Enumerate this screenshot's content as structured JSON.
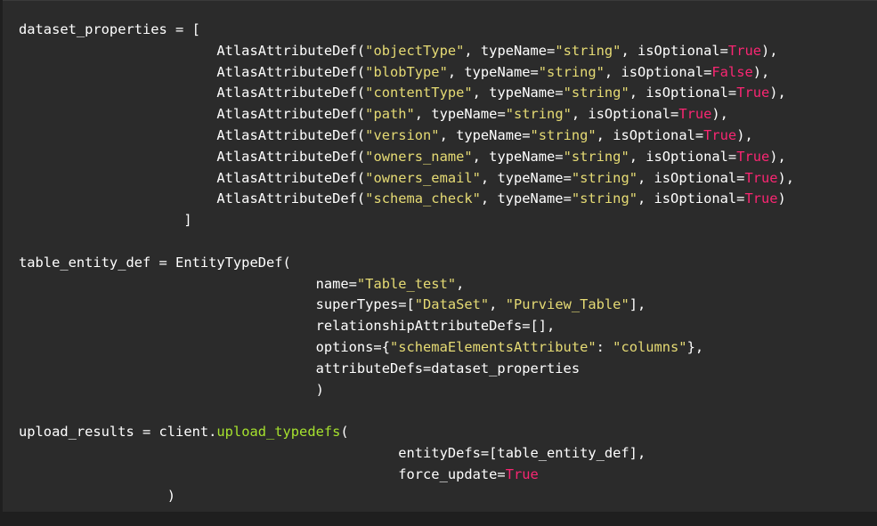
{
  "colors": {
    "background": "#2b2b2b",
    "plain": "#ffffff",
    "string": "#e6db74",
    "bool": "#f92672",
    "function": "#a6e22e"
  },
  "code": {
    "lines": [
      [
        {
          "t": "plain",
          "v": "dataset_properties = ["
        }
      ],
      [
        {
          "t": "plain",
          "v": "                        AtlasAttributeDef("
        },
        {
          "t": "string",
          "v": "\"objectType\""
        },
        {
          "t": "plain",
          "v": ", typeName="
        },
        {
          "t": "string",
          "v": "\"string\""
        },
        {
          "t": "plain",
          "v": ", isOptional="
        },
        {
          "t": "bool",
          "v": "True"
        },
        {
          "t": "plain",
          "v": "),"
        }
      ],
      [
        {
          "t": "plain",
          "v": "                        AtlasAttributeDef("
        },
        {
          "t": "string",
          "v": "\"blobType\""
        },
        {
          "t": "plain",
          "v": ", typeName="
        },
        {
          "t": "string",
          "v": "\"string\""
        },
        {
          "t": "plain",
          "v": ", isOptional="
        },
        {
          "t": "bool",
          "v": "False"
        },
        {
          "t": "plain",
          "v": "),"
        }
      ],
      [
        {
          "t": "plain",
          "v": "                        AtlasAttributeDef("
        },
        {
          "t": "string",
          "v": "\"contentType\""
        },
        {
          "t": "plain",
          "v": ", typeName="
        },
        {
          "t": "string",
          "v": "\"string\""
        },
        {
          "t": "plain",
          "v": ", isOptional="
        },
        {
          "t": "bool",
          "v": "True"
        },
        {
          "t": "plain",
          "v": "),"
        }
      ],
      [
        {
          "t": "plain",
          "v": "                        AtlasAttributeDef("
        },
        {
          "t": "string",
          "v": "\"path\""
        },
        {
          "t": "plain",
          "v": ", typeName="
        },
        {
          "t": "string",
          "v": "\"string\""
        },
        {
          "t": "plain",
          "v": ", isOptional="
        },
        {
          "t": "bool",
          "v": "True"
        },
        {
          "t": "plain",
          "v": "),"
        }
      ],
      [
        {
          "t": "plain",
          "v": "                        AtlasAttributeDef("
        },
        {
          "t": "string",
          "v": "\"version\""
        },
        {
          "t": "plain",
          "v": ", typeName="
        },
        {
          "t": "string",
          "v": "\"string\""
        },
        {
          "t": "plain",
          "v": ", isOptional="
        },
        {
          "t": "bool",
          "v": "True"
        },
        {
          "t": "plain",
          "v": "),"
        }
      ],
      [
        {
          "t": "plain",
          "v": "                        AtlasAttributeDef("
        },
        {
          "t": "string",
          "v": "\"owners_name\""
        },
        {
          "t": "plain",
          "v": ", typeName="
        },
        {
          "t": "string",
          "v": "\"string\""
        },
        {
          "t": "plain",
          "v": ", isOptional="
        },
        {
          "t": "bool",
          "v": "True"
        },
        {
          "t": "plain",
          "v": "),"
        }
      ],
      [
        {
          "t": "plain",
          "v": "                        AtlasAttributeDef("
        },
        {
          "t": "string",
          "v": "\"owners_email\""
        },
        {
          "t": "plain",
          "v": ", typeName="
        },
        {
          "t": "string",
          "v": "\"string\""
        },
        {
          "t": "plain",
          "v": ", isOptional="
        },
        {
          "t": "bool",
          "v": "True"
        },
        {
          "t": "plain",
          "v": "),"
        }
      ],
      [
        {
          "t": "plain",
          "v": "                        AtlasAttributeDef("
        },
        {
          "t": "string",
          "v": "\"schema_check\""
        },
        {
          "t": "plain",
          "v": ", typeName="
        },
        {
          "t": "string",
          "v": "\"string\""
        },
        {
          "t": "plain",
          "v": ", isOptional="
        },
        {
          "t": "bool",
          "v": "True"
        },
        {
          "t": "plain",
          "v": ")"
        }
      ],
      [
        {
          "t": "plain",
          "v": "                    ]"
        }
      ],
      [],
      [
        {
          "t": "plain",
          "v": "table_entity_def = EntityTypeDef("
        }
      ],
      [
        {
          "t": "plain",
          "v": "                                    name="
        },
        {
          "t": "string",
          "v": "\"Table_test\""
        },
        {
          "t": "plain",
          "v": ","
        }
      ],
      [
        {
          "t": "plain",
          "v": "                                    superTypes=["
        },
        {
          "t": "string",
          "v": "\"DataSet\""
        },
        {
          "t": "plain",
          "v": ", "
        },
        {
          "t": "string",
          "v": "\"Purview_Table\""
        },
        {
          "t": "plain",
          "v": "],"
        }
      ],
      [
        {
          "t": "plain",
          "v": "                                    relationshipAttributeDefs=[],"
        }
      ],
      [
        {
          "t": "plain",
          "v": "                                    options={"
        },
        {
          "t": "string",
          "v": "\"schemaElementsAttribute\""
        },
        {
          "t": "plain",
          "v": ": "
        },
        {
          "t": "string",
          "v": "\"columns\""
        },
        {
          "t": "plain",
          "v": "},"
        }
      ],
      [
        {
          "t": "plain",
          "v": "                                    attributeDefs=dataset_properties"
        }
      ],
      [
        {
          "t": "plain",
          "v": "                                    )"
        }
      ],
      [],
      [
        {
          "t": "plain",
          "v": "upload_results = client."
        },
        {
          "t": "func",
          "v": "upload_typedefs"
        },
        {
          "t": "plain",
          "v": "("
        }
      ],
      [
        {
          "t": "plain",
          "v": "                                              entityDefs=[table_entity_def],"
        }
      ],
      [
        {
          "t": "plain",
          "v": "                                              force_update="
        },
        {
          "t": "bool",
          "v": "True"
        }
      ],
      [
        {
          "t": "plain",
          "v": "                  )"
        }
      ]
    ]
  }
}
